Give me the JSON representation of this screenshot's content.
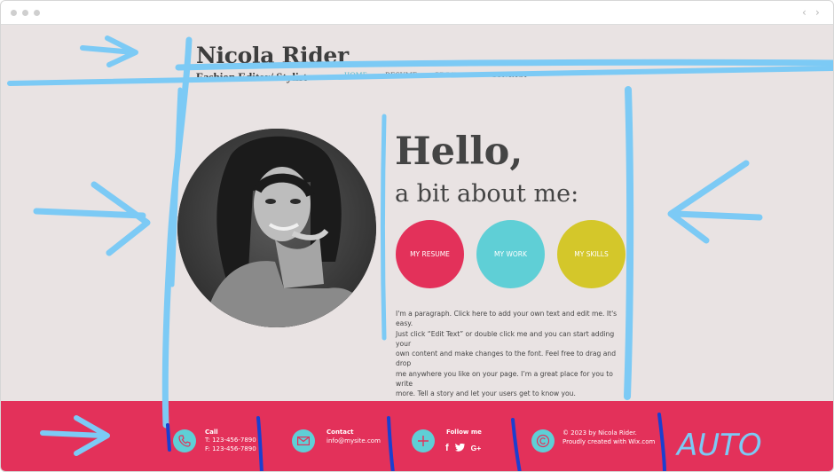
{
  "browser": {
    "back_icon": "chevron-left-icon",
    "forward_icon": "chevron-right-icon"
  },
  "site": {
    "brand": "Nicola Rider",
    "tagline": "Fashion Editor/ Stylist",
    "menu": [
      {
        "label": "HOME",
        "active": true
      },
      {
        "label": "RESUME",
        "active": false
      },
      {
        "label": "PROJECTS",
        "active": false
      },
      {
        "label": "CONTACT",
        "active": false
      }
    ]
  },
  "hero": {
    "heading": "Hello,",
    "subheading": "a bit about me:",
    "buttons": [
      {
        "label": "MY RESUME",
        "color": "#e3315a"
      },
      {
        "label": "MY WORK",
        "color": "#5fcfd6"
      },
      {
        "label": "MY SKILLS",
        "color": "#d4c72a"
      }
    ],
    "paragraph_lines": [
      "I'm a paragraph. Click here to add your own text and edit me. It's easy.",
      "Just click “Edit Text” or double click me and you can start adding your",
      "own content and make changes to the font. Feel free to drag and drop",
      "me anywhere you like on your page. I’m a great place for you to write",
      "more. Tell a story and let your users get to know you."
    ]
  },
  "footer": {
    "color": "#e3315a",
    "call": {
      "title": "Call",
      "lines": [
        "T: 123-456-7890",
        "F: 123-456-7890"
      ]
    },
    "contact": {
      "title": "Contact",
      "lines": [
        "info@mysite.com"
      ]
    },
    "follow": {
      "title": "Follow me",
      "icons": [
        "facebook-icon",
        "twitter-icon",
        "google-plus-icon"
      ]
    },
    "copyright": {
      "lines": [
        "© 2023 by Nicola Rider.",
        "Proudly created with Wix.com"
      ]
    }
  },
  "annotation": {
    "handwritten_text": "AUTO",
    "colors": {
      "light_blue": "#7ccaf5",
      "dark_blue": "#1b3fd0"
    }
  }
}
